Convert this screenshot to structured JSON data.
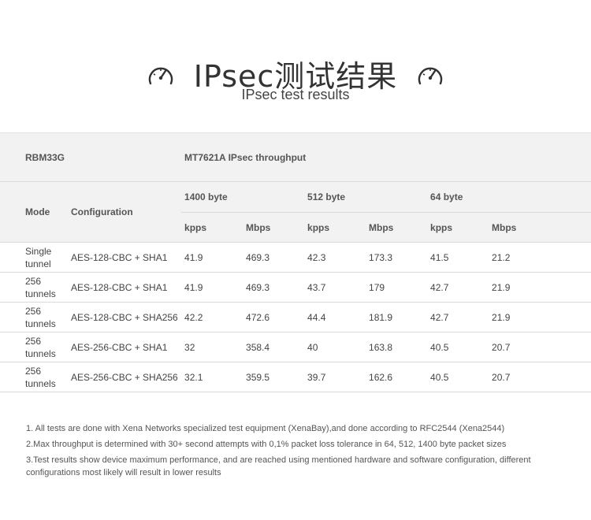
{
  "header": {
    "title_cn": "IPsec测试结果",
    "title_en": "IPsec test results",
    "icon": "gauge-icon"
  },
  "table": {
    "device": "RBM33G",
    "throughput_title": "MT7621A IPsec throughput",
    "col_mode": "Mode",
    "col_config": "Configuration",
    "groups": [
      "1400 byte",
      "512 byte",
      "64 byte"
    ],
    "units": [
      "kpps",
      "Mbps",
      "kpps",
      "Mbps",
      "kpps",
      "Mbps"
    ],
    "rows": [
      {
        "mode": "Single tunnel",
        "config": "AES-128-CBC + SHA1",
        "values": [
          "41.9",
          "469.3",
          "42.3",
          "173.3",
          "41.5",
          "21.2"
        ]
      },
      {
        "mode": "256 tunnels",
        "config": "AES-128-CBC + SHA1",
        "values": [
          "41.9",
          "469.3",
          "43.7",
          "179",
          "42.7",
          "21.9"
        ]
      },
      {
        "mode": "256 tunnels",
        "config": "AES-128-CBC + SHA256",
        "values": [
          "42.2",
          "472.6",
          "44.4",
          "181.9",
          "42.7",
          "21.9"
        ]
      },
      {
        "mode": "256 tunnels",
        "config": "AES-256-CBC + SHA1",
        "values": [
          "32",
          "358.4",
          "40",
          "163.8",
          "40.5",
          "20.7"
        ]
      },
      {
        "mode": "256 tunnels",
        "config": "AES-256-CBC + SHA256",
        "values": [
          "32.1",
          "359.5",
          "39.7",
          "162.6",
          "40.5",
          "20.7"
        ]
      }
    ]
  },
  "notes": [
    "1. All tests are done with Xena Networks specialized test equipment (XenaBay),and done according to RFC2544 (Xena2544)",
    "2.Max throughput is determined with 30+ second attempts with 0,1% packet loss tolerance in 64, 512, 1400 byte packet sizes",
    "3.Test results show device maximum performance, and are reached using mentioned hardware and software configuration, different configurations most likely will result in lower results"
  ]
}
